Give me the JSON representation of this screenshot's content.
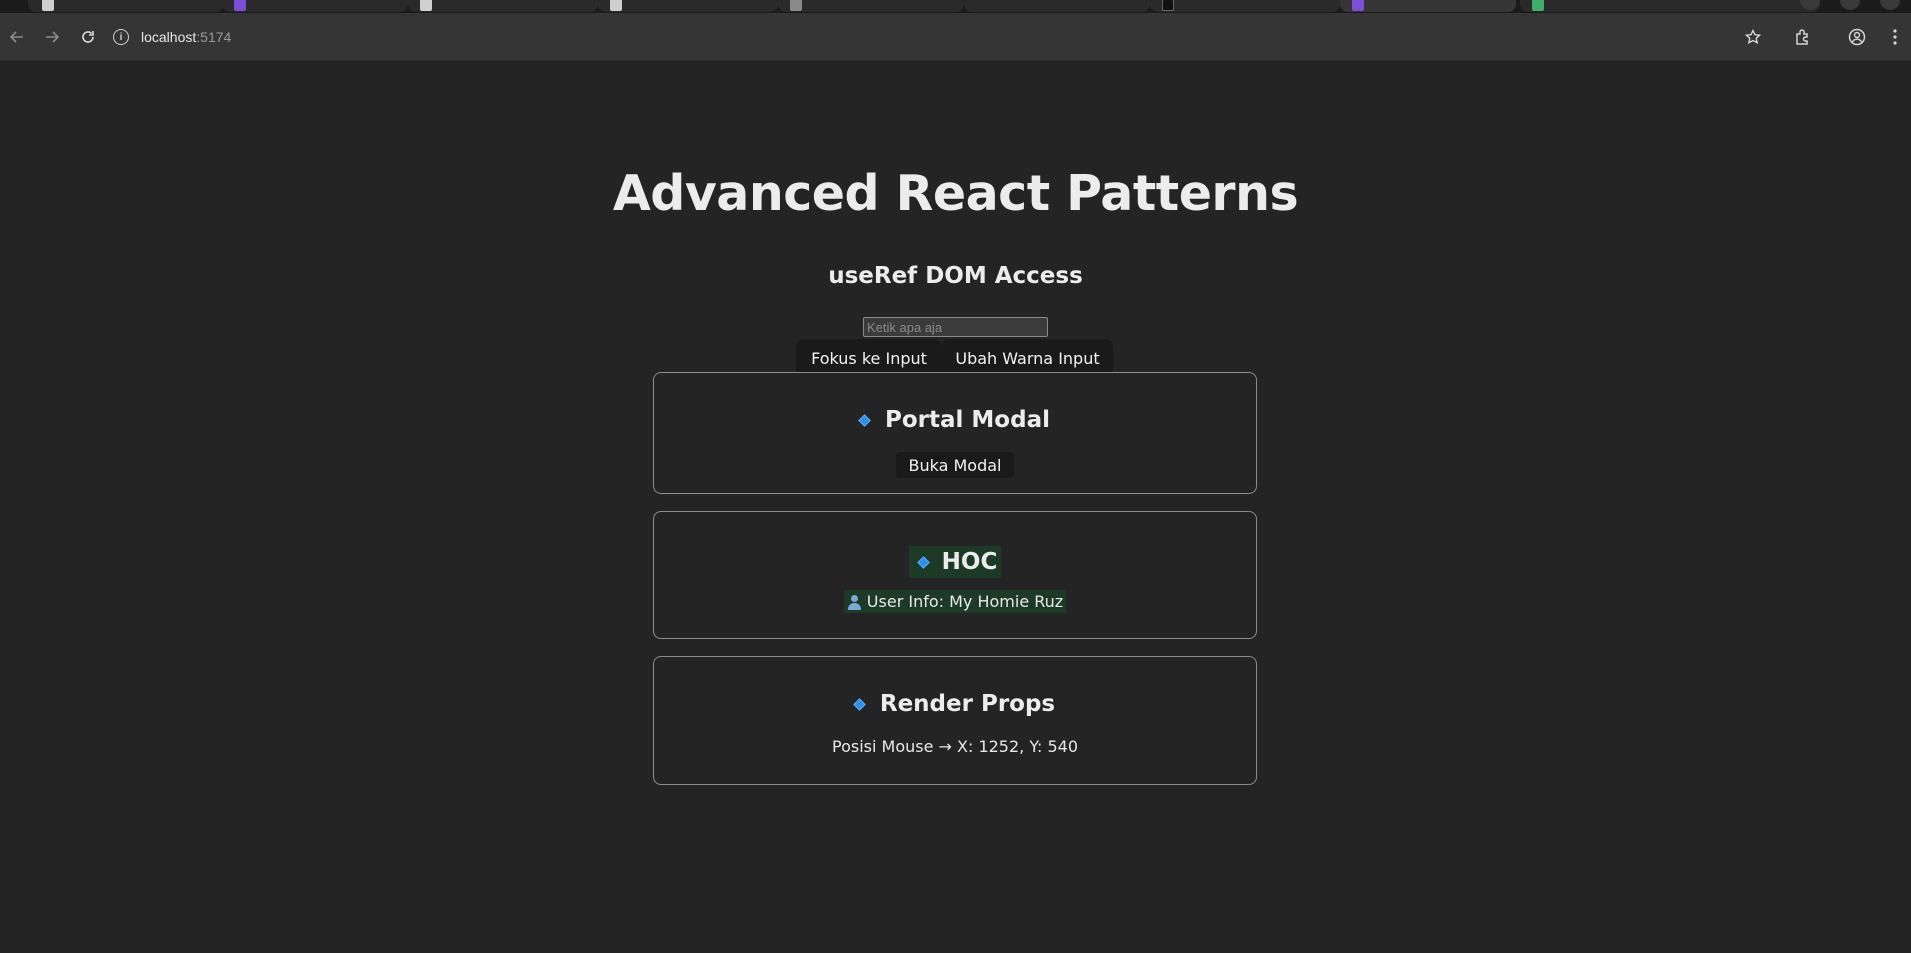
{
  "browser": {
    "url_host": "localhost",
    "url_port": ":5174"
  },
  "page": {
    "title": "Advanced React Patterns",
    "useref": {
      "heading": "useRef DOM Access",
      "input_placeholder": "Ketik apa aja",
      "input_value": "",
      "focus_button": "Fokus ke Input",
      "color_button": "Ubah Warna Input"
    },
    "portal": {
      "heading": "Portal Modal",
      "open_button": "Buka Modal"
    },
    "hoc": {
      "heading": "HOC",
      "user_info": "User Info: My Homie Ruz"
    },
    "render_props": {
      "heading": "Render Props",
      "mouse_position": "Posisi Mouse → X: 1252, Y: 540"
    }
  },
  "colors": {
    "background": "#242424",
    "button_bg": "#1a1a1a",
    "accent_diamond": "#2f8fe8",
    "hoc_highlight": "#1d3a27",
    "card_border": "#8c8c8c"
  },
  "icons": [
    "back-arrow-icon",
    "forward-arrow-icon",
    "reload-icon",
    "site-info-icon",
    "bookmark-star-icon",
    "extensions-icon",
    "profile-icon",
    "menu-dots-icon",
    "diamond-icon",
    "person-icon"
  ]
}
